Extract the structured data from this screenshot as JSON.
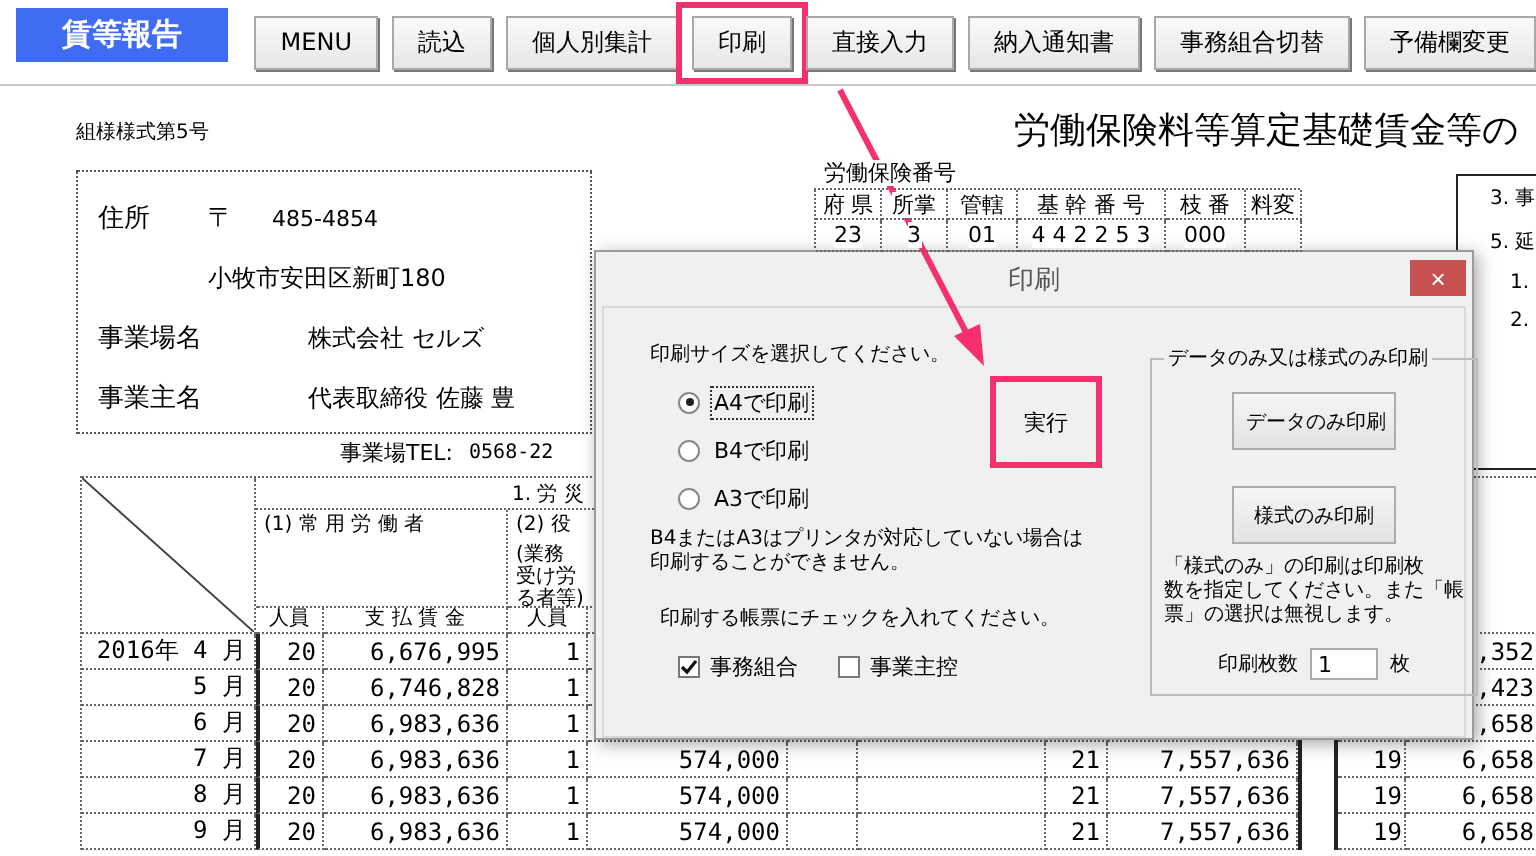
{
  "toolbar": {
    "title": "賃等報告",
    "buttons": [
      {
        "label": "MENU",
        "highlighted": false
      },
      {
        "label": "読込",
        "highlighted": false
      },
      {
        "label": "個人別集計",
        "highlighted": false
      },
      {
        "label": "印刷",
        "highlighted": true
      },
      {
        "label": "直接入力",
        "highlighted": false
      },
      {
        "label": "納入通知書",
        "highlighted": false
      },
      {
        "label": "事務組合切替",
        "highlighted": false
      },
      {
        "label": "予備欄変更",
        "highlighted": false
      }
    ]
  },
  "sheet": {
    "form_code": "組様様式第5号",
    "title": "労働保険料等算定基礎賃金等の",
    "address": {
      "label": "住所",
      "postal_mark": "〒",
      "postal_code": "485-4854",
      "street": "小牧市安田区新町180"
    },
    "business_name": {
      "label": "事業場名",
      "value": "株式会社 セルズ"
    },
    "owner": {
      "label": "事業主名",
      "value": "代表取締役 佐藤 豊"
    },
    "tel": {
      "label": "事業場TEL:",
      "value": "0568-22"
    },
    "insurance": {
      "label": "労働保険番号",
      "columns": [
        "府 県",
        "所掌",
        "管轄",
        "基 幹 番 号",
        "枝 番",
        "料変"
      ],
      "values": [
        "23",
        "3",
        "01",
        "4 4 2 2 5 3",
        "000"
      ]
    },
    "side_box": [
      "3. 事",
      "5. 延",
      "1.",
      "2."
    ],
    "table": {
      "section_header": "1. 労 災",
      "group_headers": [
        {
          "label": "(1) 常 用 労 働 者"
        },
        {
          "label": "(2) 役",
          "note": [
            "(業務",
            "受け労",
            "る者等)"
          ]
        }
      ],
      "subheaders": [
        "人員",
        "支 払 賃 金",
        "人員"
      ],
      "rows": [
        {
          "month": "2016年 4 月",
          "cells": {
            "column_2": "20",
            "column_3": "6,676,995",
            "column_4": "1",
            "column_12": ",352"
          }
        },
        {
          "month": "5 月",
          "cells": {
            "column_2": "20",
            "column_3": "6,746,828",
            "column_4": "1",
            "column_12": ",423"
          }
        },
        {
          "month": "6 月",
          "cells": {
            "column_2": "20",
            "column_3": "6,983,636",
            "column_4": "1",
            "column_12": ",658"
          }
        },
        {
          "month": "7 月",
          "cells": {
            "column_2": "20",
            "column_3": "6,983,636",
            "column_4": "1",
            "column_5": "574,000",
            "column_8": "21",
            "column_9": "7,557,636",
            "column_11": "19",
            "column_12": "6,658"
          }
        },
        {
          "month": "8 月",
          "cells": {
            "column_2": "20",
            "column_3": "6,983,636",
            "column_4": "1",
            "column_5": "574,000",
            "column_8": "21",
            "column_9": "7,557,636",
            "column_11": "19",
            "column_12": "6,658"
          }
        },
        {
          "month": "9 月",
          "cells": {
            "column_2": "20",
            "column_3": "6,983,636",
            "column_4": "1",
            "column_5": "574,000",
            "column_8": "21",
            "column_9": "7,557,636",
            "column_11": "19",
            "column_12": "6,658"
          }
        }
      ]
    }
  },
  "dialog": {
    "title": "印刷",
    "close": "×",
    "size_prompt": "印刷サイズを選択してください。",
    "sizes": [
      {
        "label": "A4で印刷",
        "selected": true
      },
      {
        "label": "B4で印刷",
        "selected": false
      },
      {
        "label": "A3で印刷",
        "selected": false
      }
    ],
    "size_note": [
      "B4またはA3はプリンタが対応していない場合は",
      "印刷することができません。"
    ],
    "form_prompt": "印刷する帳票にチェックを入れてください。",
    "forms": [
      {
        "label": "事務組合",
        "checked": true
      },
      {
        "label": "事業主控",
        "checked": false
      }
    ],
    "run_button": {
      "label": "実行",
      "highlighted": true
    },
    "group": {
      "legend": "データのみ又は様式のみ印刷",
      "buttons": [
        "データのみ印刷",
        "様式のみ印刷"
      ],
      "note": [
        "「様式のみ」の印刷は印刷枚",
        "数を指定してください。また「帳",
        "票」の選択は無視します。"
      ],
      "copies_label": "印刷枚数",
      "copies": "1",
      "copies_unit": "枚"
    }
  }
}
